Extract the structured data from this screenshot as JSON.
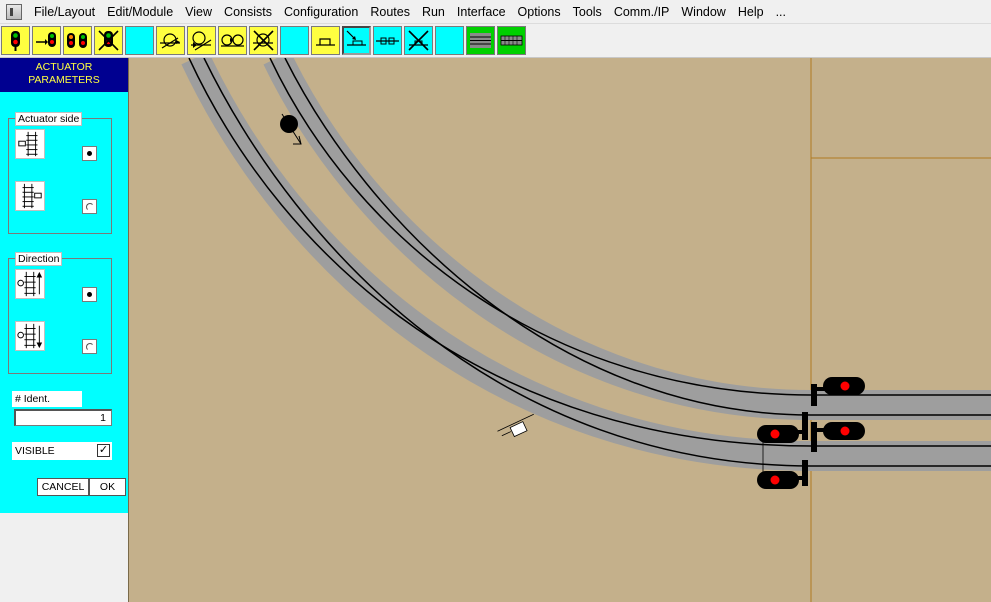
{
  "menu": {
    "items": [
      "File/Layout",
      "Edit/Module",
      "View",
      "Consists",
      "Configuration",
      "Routes",
      "Run",
      "Interface",
      "Options",
      "Tools",
      "Comm./IP",
      "Window",
      "Help",
      "..."
    ]
  },
  "toolbar": {
    "buttons": [
      {
        "name": "signal-2-aspect-tool",
        "color": "yellow"
      },
      {
        "name": "signal-block-tool",
        "color": "yellow"
      },
      {
        "name": "signal-3-aspect-tool",
        "color": "yellow"
      },
      {
        "name": "signal-delete-tool",
        "color": "yellow"
      },
      {
        "name": "blank-tool-1",
        "color": "cyan"
      },
      {
        "name": "turnout-motor-tool",
        "color": "yellow"
      },
      {
        "name": "turnout-motor-2-tool",
        "color": "yellow"
      },
      {
        "name": "turnout-double-tool",
        "color": "yellow"
      },
      {
        "name": "turnout-delete-tool",
        "color": "yellow"
      },
      {
        "name": "blank-tool-2",
        "color": "cyan"
      },
      {
        "name": "bumper-tool",
        "color": "yellow"
      },
      {
        "name": "actuator-tool",
        "color": "cyan",
        "active": true
      },
      {
        "name": "isolator-tool",
        "color": "cyan"
      },
      {
        "name": "actuator-delete-tool",
        "color": "cyan"
      },
      {
        "name": "blank-tool-3",
        "color": "cyan"
      },
      {
        "name": "track-lines-tool",
        "color": "green"
      },
      {
        "name": "track-panel-tool",
        "color": "green"
      }
    ]
  },
  "panel": {
    "title_line1": "ACTUATOR",
    "title_line2": "PARAMETERS",
    "actuator_side": {
      "legend": "Actuator side",
      "selected": "left"
    },
    "direction": {
      "legend": "Direction",
      "selected": "up"
    },
    "ident_label": "# Ident.",
    "ident_value": "1",
    "visible_label": "VISIBLE",
    "visible_checked": "✓",
    "cancel_label": "CANCEL",
    "ok_label": "OK"
  },
  "colors": {
    "panel_bg": "#00ffff",
    "title_bg": "#000090",
    "title_fg": "#ffff40",
    "canvas_bg": "#c4b08b",
    "track_bed": "#9e9e9e",
    "signal_lamp": "#ff0000"
  }
}
